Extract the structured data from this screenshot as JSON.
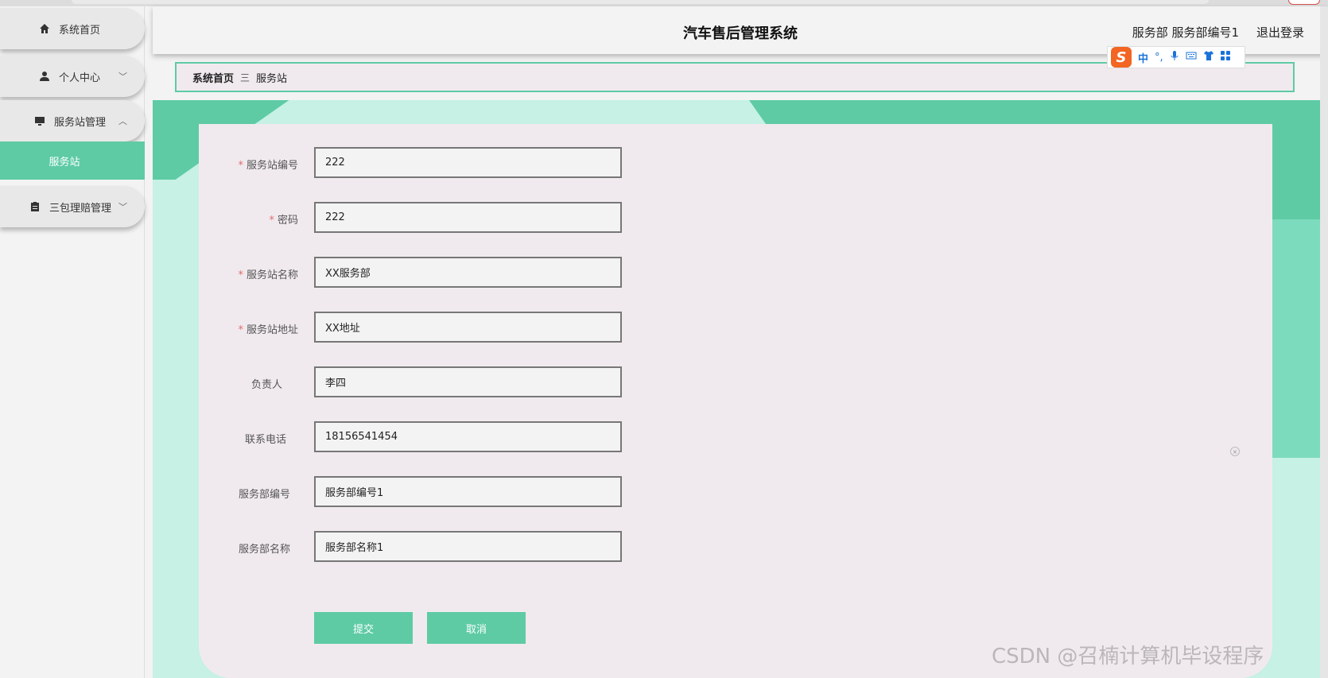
{
  "header": {
    "title": "汽车售后管理系统",
    "user": "服务部 服务部编号1",
    "logout": "退出登录"
  },
  "sidebar": {
    "items": [
      {
        "label": "系统首页",
        "icon": "home-icon"
      },
      {
        "label": "个人中心",
        "icon": "user-icon"
      },
      {
        "label": "服务站管理",
        "icon": "monitor-icon"
      },
      {
        "label": "服务站",
        "icon": ""
      },
      {
        "label": "三包理赔管理",
        "icon": "clipboard-icon"
      }
    ]
  },
  "breadcrumb": {
    "home": "系统首页",
    "separator": "三",
    "current": "服务站"
  },
  "ime": {
    "logo": "S",
    "lang": "中",
    "punct": "°,",
    "items": [
      "mic-icon",
      "keyboard-icon",
      "shirt-icon",
      "grid-icon"
    ]
  },
  "form": {
    "fields": [
      {
        "label": "服务站编号",
        "required": true,
        "value": "222"
      },
      {
        "label": "密码",
        "required": true,
        "value": "222"
      },
      {
        "label": "服务站名称",
        "required": true,
        "value": "XX服务部"
      },
      {
        "label": "服务站地址",
        "required": true,
        "value": "XX地址"
      },
      {
        "label": "负责人",
        "required": false,
        "value": "李四"
      },
      {
        "label": "联系电话",
        "required": false,
        "value": "18156541454"
      },
      {
        "label": "服务部编号",
        "required": false,
        "value": "服务部编号1"
      },
      {
        "label": "服务部名称",
        "required": false,
        "value": "服务部名称1"
      }
    ],
    "submit": "提交",
    "cancel": "取消"
  },
  "watermark": "CSDN @召楠计算机毕设程序",
  "colors": {
    "accent": "#5ecba5",
    "required": "#e36d6d"
  }
}
